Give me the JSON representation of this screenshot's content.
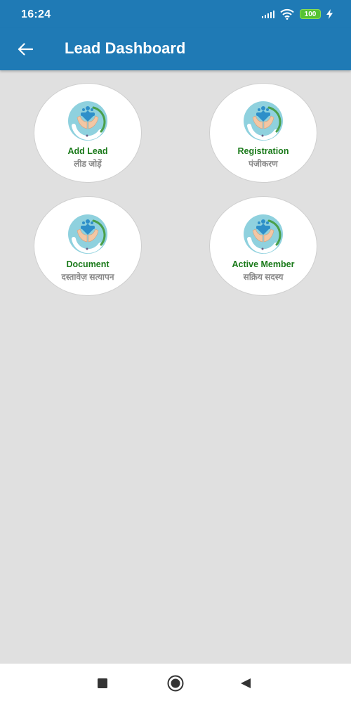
{
  "status_bar": {
    "time": "16:24",
    "battery_level": "100",
    "icons": [
      "signal-icon",
      "wifi-icon",
      "battery-icon",
      "charging-icon"
    ]
  },
  "app_bar": {
    "title": "Lead Dashboard",
    "back_icon": "arrow-left-icon"
  },
  "colors": {
    "primary": "#1f7ab5",
    "background": "#e0e0e0",
    "label_english": "#1a7a1a",
    "label_hindi": "#8a8a8a",
    "battery": "#55c232"
  },
  "dashboard": {
    "items": [
      {
        "label_en": "Add Lead",
        "label_hi": "लीड जोड़ें",
        "icon": "hands-logo-icon"
      },
      {
        "label_en": "Registration",
        "label_hi": "पंजीकरण",
        "icon": "hands-logo-icon"
      },
      {
        "label_en": "Document",
        "label_hi": "दस्तावेज़ सत्यापन",
        "icon": "hands-logo-icon"
      },
      {
        "label_en": "Active Member",
        "label_hi": "सक्रिय सदस्य",
        "icon": "hands-logo-icon"
      }
    ]
  },
  "nav_bar": {
    "icons": [
      "recents-square-icon",
      "home-circle-icon",
      "back-triangle-icon"
    ]
  }
}
